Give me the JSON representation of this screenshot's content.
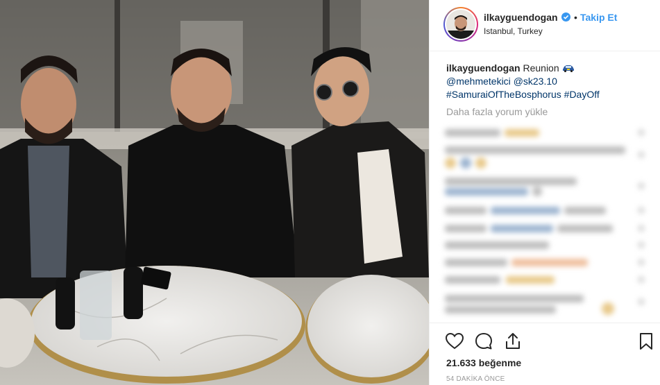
{
  "post": {
    "username": "ilkayguendogan",
    "follow_label": "Takip Et",
    "separator": "•",
    "location": "Istanbul, Turkey"
  },
  "caption": {
    "username": "ilkayguendogan",
    "text": "Reunion",
    "mention1": "@mehmetekici",
    "mention2": "@sk23.10",
    "hashtag1": "#SamuraiOfTheBosphorus",
    "hashtag2": "#DayOff"
  },
  "comments": {
    "load_more_label": "Daha fazla yorum yükle"
  },
  "footer": {
    "likes": "21.633 beğenme",
    "timestamp": "54 DAKİKA ÖNCE"
  },
  "icons": {
    "verified": "verified-badge-icon",
    "like": "heart-icon",
    "comment": "comment-icon",
    "share": "share-icon",
    "save": "bookmark-icon",
    "caption_emoji": "car-emoji-icon"
  },
  "colors": {
    "link": "#3897f0",
    "mention": "#003569",
    "verified": "#3897f0",
    "muted": "#999999"
  }
}
